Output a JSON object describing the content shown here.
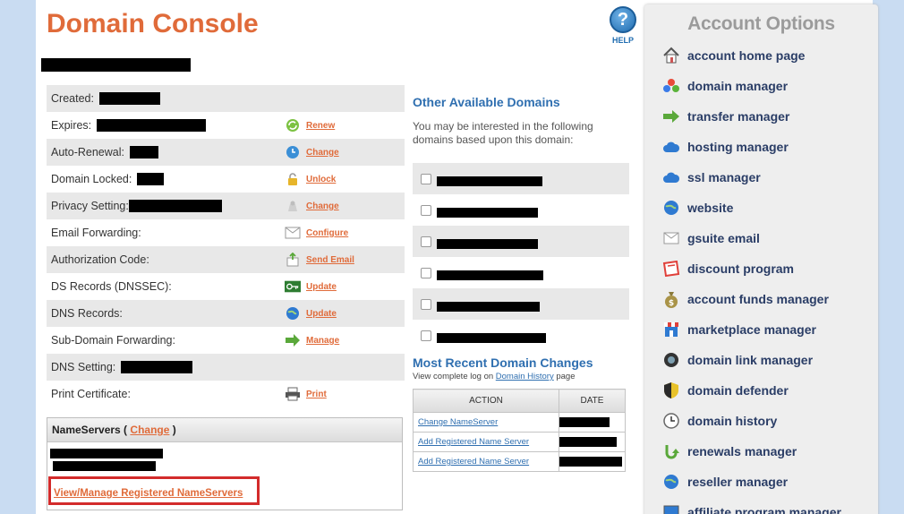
{
  "header": {
    "title": "Domain Console",
    "help_label": "HELP"
  },
  "details": {
    "rows": [
      {
        "label": "Created:",
        "action": "",
        "icon": ""
      },
      {
        "label": "Expires:",
        "action": "Renew",
        "icon": "renew-icon"
      },
      {
        "label": "Auto-Renewal:",
        "action": "Change",
        "icon": "clock-icon"
      },
      {
        "label": "Domain Locked:",
        "action": "Unlock",
        "icon": "padlock-icon"
      },
      {
        "label": "Privacy Setting:",
        "action": "Change",
        "icon": "privacy-icon"
      },
      {
        "label": "Email Forwarding:",
        "action": "Configure",
        "icon": "envelope-icon"
      },
      {
        "label": "Authorization Code:",
        "action": "Send Email",
        "icon": "mail-send-icon"
      },
      {
        "label": "DS Records (DNSSEC):",
        "action": "Update",
        "icon": "key-icon"
      },
      {
        "label": "DNS Records:",
        "action": "Update",
        "icon": "globe-icon"
      },
      {
        "label": "Sub-Domain Forwarding:",
        "action": "Manage",
        "icon": "arrow-right-icon"
      },
      {
        "label": "DNS Setting:",
        "action": "",
        "icon": ""
      },
      {
        "label": "Print Certificate:",
        "action": "Print",
        "icon": "printer-icon"
      }
    ]
  },
  "nameservers": {
    "title": "NameServers (",
    "change_label": "Change",
    "title_end": ")",
    "manage_link": "View/Manage Registered NameServers"
  },
  "other_domains": {
    "title": "Other Available Domains",
    "description": "You may be interested in the following domains based upon this domain:"
  },
  "recent_changes": {
    "title": "Most Recent Domain Changes",
    "desc_prefix": "View complete log on",
    "desc_link": "Domain History",
    "desc_suffix": "page",
    "col_action": "ACTION",
    "col_date": "DATE",
    "rows": [
      {
        "action": "Change NameServer"
      },
      {
        "action": "Add Registered Name Server"
      },
      {
        "action": "Add Registered Name Server"
      }
    ]
  },
  "sidebar": {
    "title": "Account Options",
    "items": [
      {
        "label": "account home page",
        "icon": "home-icon"
      },
      {
        "label": "domain manager",
        "icon": "domain-balls-icon"
      },
      {
        "label": "transfer manager",
        "icon": "transfer-arrow-icon"
      },
      {
        "label": "hosting manager",
        "icon": "cloud-icon"
      },
      {
        "label": "ssl manager",
        "icon": "cloud-icon"
      },
      {
        "label": "website",
        "icon": "globe-icon"
      },
      {
        "label": "gsuite email",
        "icon": "envelope-icon"
      },
      {
        "label": "discount program",
        "icon": "ticket-icon"
      },
      {
        "label": "account funds manager",
        "icon": "money-bag-icon"
      },
      {
        "label": "marketplace manager",
        "icon": "storefront-icon"
      },
      {
        "label": "domain link manager",
        "icon": "link-sphere-icon"
      },
      {
        "label": "domain defender",
        "icon": "shield-icon"
      },
      {
        "label": "domain history",
        "icon": "clock-icon"
      },
      {
        "label": "renewals manager",
        "icon": "renew-arrow-icon"
      },
      {
        "label": "reseller manager",
        "icon": "globe-icon"
      },
      {
        "label": "affiliate program manager",
        "icon": "monitor-icon"
      }
    ]
  },
  "colors": {
    "accent_orange": "#e06b3a",
    "link_blue": "#2f6fb0",
    "nav_navy": "#2a3d66",
    "highlight_red": "#d32b2b"
  }
}
